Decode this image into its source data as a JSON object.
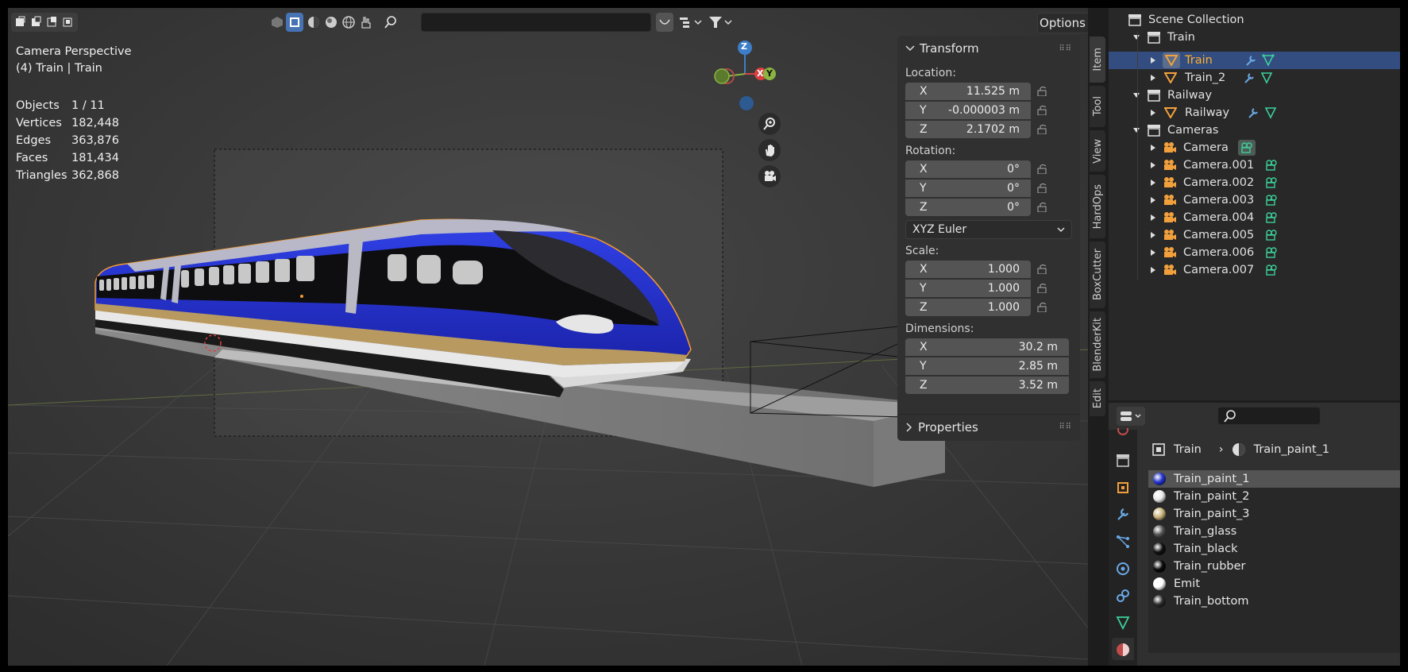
{
  "viewport": {
    "search_placeholder": "",
    "options_label": "Options",
    "overlay": {
      "view_name": "Camera Perspective",
      "object_name": "(4) Train | Train"
    },
    "stats": [
      {
        "label": "Objects",
        "value": "1 / 11"
      },
      {
        "label": "Vertices",
        "value": "182,448"
      },
      {
        "label": "Edges",
        "value": "363,876"
      },
      {
        "label": "Faces",
        "value": "181,434"
      },
      {
        "label": "Triangles",
        "value": "362,868"
      }
    ],
    "gizmo": {
      "x": "X",
      "y": "Y",
      "z": "Z"
    }
  },
  "npanel": {
    "transform_title": "Transform",
    "location_label": "Location:",
    "location": [
      {
        "axis": "X",
        "value": "11.525 m"
      },
      {
        "axis": "Y",
        "value": "-0.000003 m"
      },
      {
        "axis": "Z",
        "value": "2.1702 m"
      }
    ],
    "rotation_label": "Rotation:",
    "rotation": [
      {
        "axis": "X",
        "value": "0°"
      },
      {
        "axis": "Y",
        "value": "0°"
      },
      {
        "axis": "Z",
        "value": "0°"
      }
    ],
    "rotation_mode": "XYZ Euler",
    "scale_label": "Scale:",
    "scale": [
      {
        "axis": "X",
        "value": "1.000"
      },
      {
        "axis": "Y",
        "value": "1.000"
      },
      {
        "axis": "Z",
        "value": "1.000"
      }
    ],
    "dimensions_label": "Dimensions:",
    "dimensions": [
      {
        "axis": "X",
        "value": "30.2 m"
      },
      {
        "axis": "Y",
        "value": "2.85 m"
      },
      {
        "axis": "Z",
        "value": "3.52 m"
      }
    ],
    "properties_title": "Properties"
  },
  "tabs": [
    "Item",
    "Tool",
    "View",
    "HardOps",
    "BoxCutter",
    "BlenderKit",
    "Edit"
  ],
  "outliner": {
    "rows": [
      {
        "label": "Scene Collection",
        "type": "scene"
      },
      {
        "label": "Train",
        "type": "collection"
      },
      {
        "label": "Train",
        "type": "mesh",
        "selected": true
      },
      {
        "label": "Train_2",
        "type": "mesh"
      },
      {
        "label": "Railway",
        "type": "collection"
      },
      {
        "label": "Railway",
        "type": "mesh"
      },
      {
        "label": "Cameras",
        "type": "collection"
      },
      {
        "label": "Camera",
        "type": "camera"
      },
      {
        "label": "Camera.001",
        "type": "camera"
      },
      {
        "label": "Camera.002",
        "type": "camera"
      },
      {
        "label": "Camera.003",
        "type": "camera"
      },
      {
        "label": "Camera.004",
        "type": "camera"
      },
      {
        "label": "Camera.005",
        "type": "camera"
      },
      {
        "label": "Camera.006",
        "type": "camera"
      },
      {
        "label": "Camera.007",
        "type": "camera"
      }
    ]
  },
  "properties": {
    "breadcrumb_object": "Train",
    "breadcrumb_material": "Train_paint_1",
    "materials": [
      {
        "name": "Train_paint_1",
        "color": "#2233cc"
      },
      {
        "name": "Train_paint_2",
        "color": "#e8e8e8"
      },
      {
        "name": "Train_paint_3",
        "color": "#c9b27a"
      },
      {
        "name": "Train_glass",
        "color": "#555555"
      },
      {
        "name": "Train_black",
        "color": "#111111"
      },
      {
        "name": "Train_rubber",
        "color": "#0a0a0a"
      },
      {
        "name": "Emit",
        "color": "#ffffff"
      },
      {
        "name": "Train_bottom",
        "color": "#2a2a2a"
      }
    ]
  },
  "colors": {
    "accent": "#4772b3",
    "selection_orange": "#ffaf29",
    "train_blue": "#1f2ecf"
  }
}
